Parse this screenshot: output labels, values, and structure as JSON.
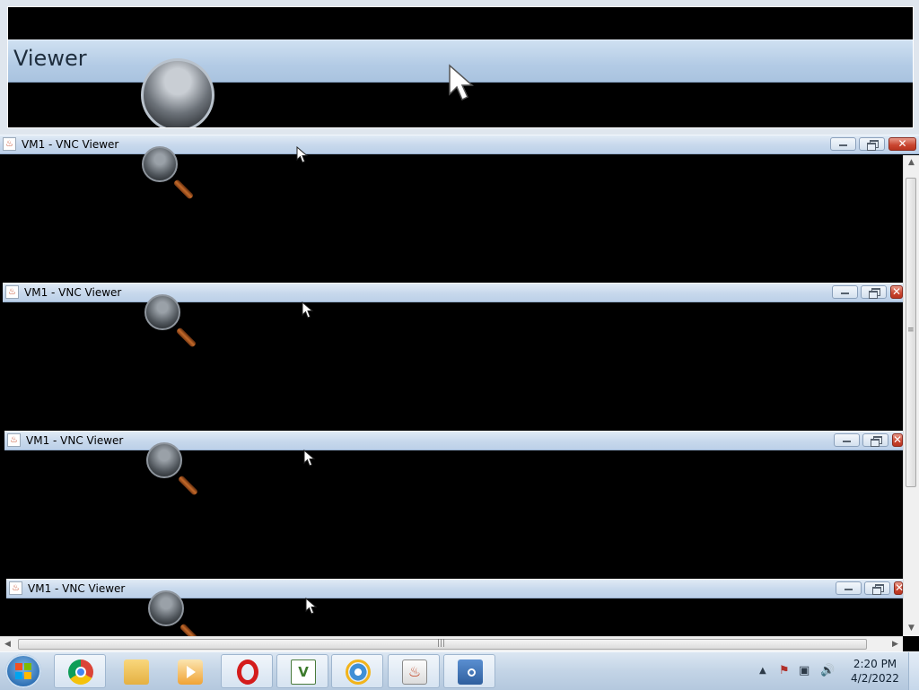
{
  "zoom_view": {
    "title_fragment": "Viewer"
  },
  "windows": [
    {
      "title": "VM1 - VNC Viewer"
    },
    {
      "title": "VM1 - VNC Viewer"
    },
    {
      "title": "VM1 - VNC Viewer"
    },
    {
      "title": "VM1 - VNC Viewer"
    }
  ],
  "taskbar": {
    "apps": [
      "chrome-icon",
      "folder-icon",
      "media-player-icon",
      "opera-icon",
      "vnc-icon",
      "internet-explorer-icon",
      "java-icon",
      "network-icon"
    ]
  },
  "clock": {
    "time": "2:20 PM",
    "date": "4/2/2022"
  }
}
